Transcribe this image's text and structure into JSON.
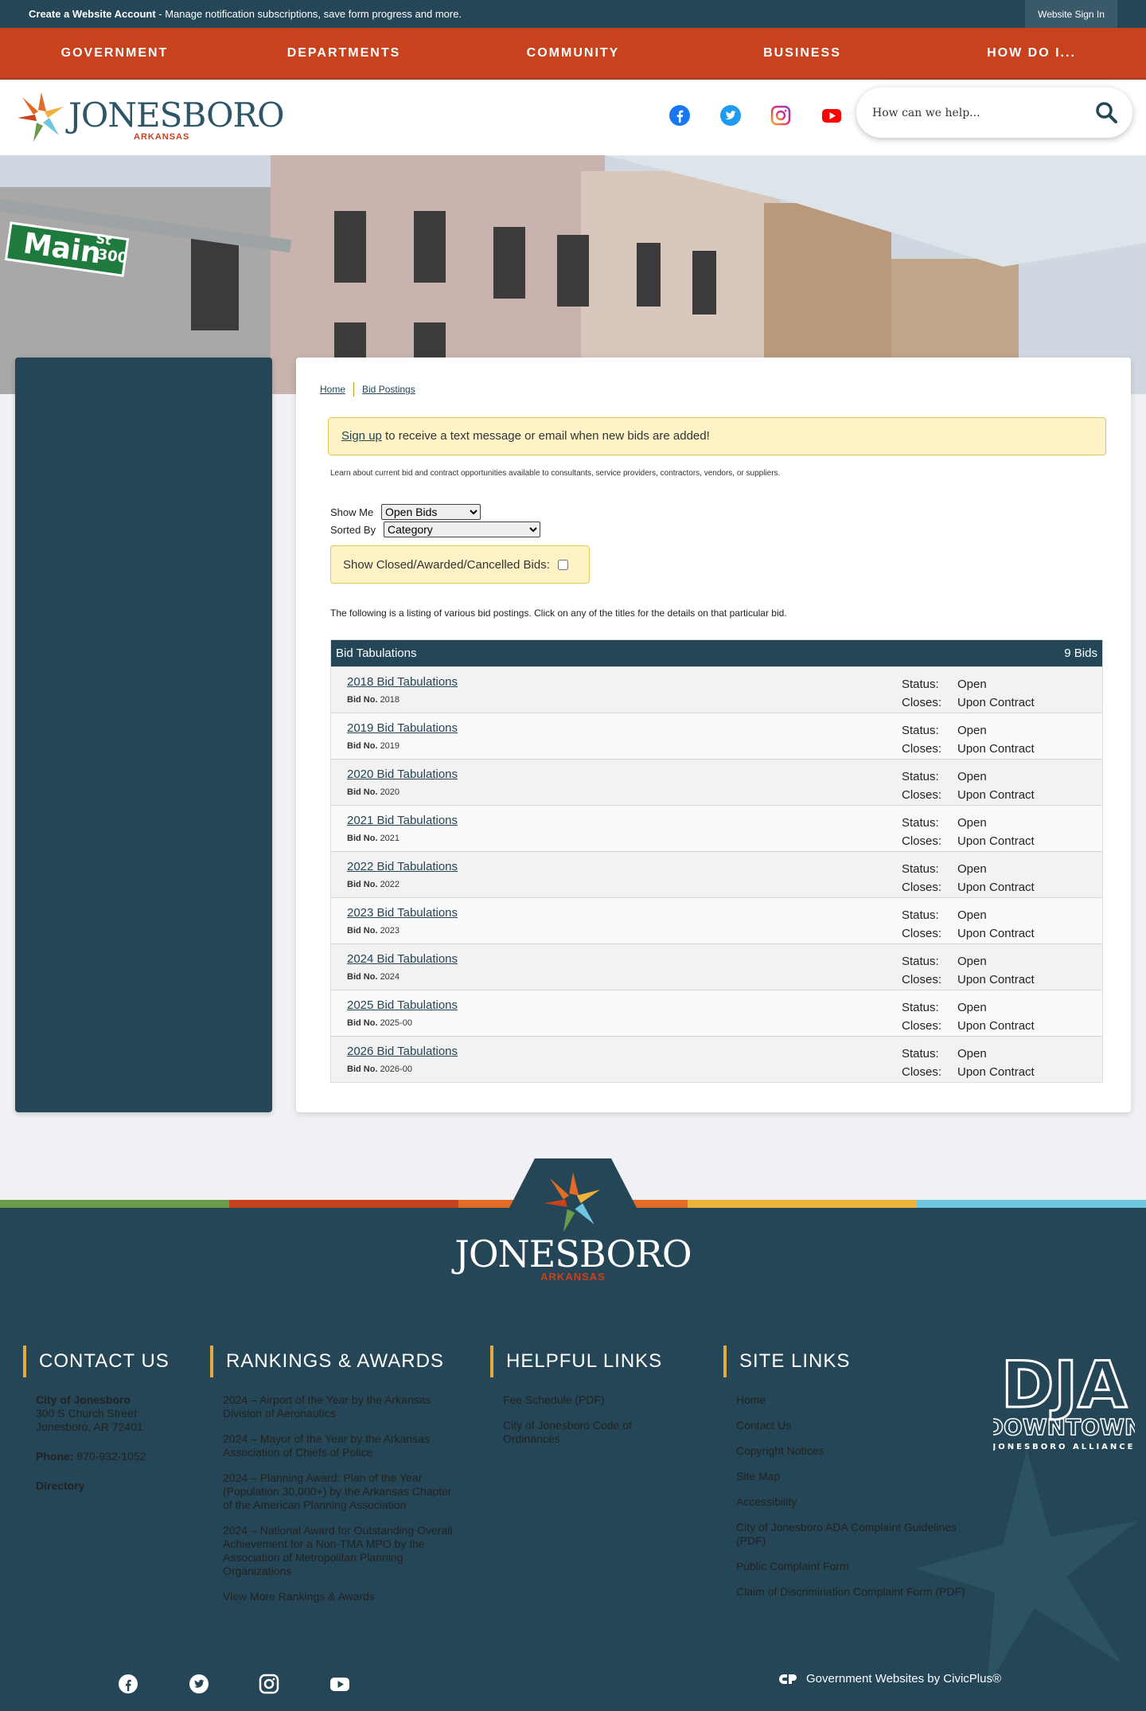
{
  "topbar": {
    "create_bold": "Create a Website Account",
    "create_rest": " - Manage notification subscriptions, save form progress and more.",
    "signin": "Website Sign In"
  },
  "nav": [
    "GOVERNMENT",
    "DEPARTMENTS",
    "COMMUNITY",
    "BUSINESS",
    "HOW DO I..."
  ],
  "header": {
    "logo_text": "JONESBORO",
    "logo_sub": "ARKANSAS",
    "search_placeholder": "How can we help...",
    "social": [
      "facebook-icon",
      "twitter-icon",
      "instagram-icon",
      "youtube-icon"
    ]
  },
  "breadcrumb": [
    "Home",
    "Bid Postings"
  ],
  "notice": {
    "link": "Sign up",
    "text": " to receive a text message or email when new bids are added!"
  },
  "intro": "Learn about current bid and contract opportunities available to consultants, service providers, contractors, vendors, or suppliers.",
  "filters": {
    "show_me_label": "Show Me",
    "show_me_value": "Open Bids",
    "sorted_by_label": "Sorted By",
    "sorted_by_value": "Category",
    "closed_label": "Show Closed/Awarded/Cancelled Bids:"
  },
  "listing_text": "The following is a listing of various bid postings. Click on any of the titles for the details on that particular bid.",
  "bid_table": {
    "title": "Bid Tabulations",
    "count": "9 Bids",
    "bid_no_label": "Bid No.",
    "status_label": "Status:",
    "closes_label": "Closes:",
    "rows": [
      {
        "title": "2018 Bid Tabulations",
        "bid_no": "2018",
        "status": "Open",
        "closes": "Upon Contract"
      },
      {
        "title": "2019 Bid Tabulations",
        "bid_no": "2019",
        "status": "Open",
        "closes": "Upon Contract"
      },
      {
        "title": "2020 Bid Tabulations",
        "bid_no": "2020",
        "status": "Open",
        "closes": "Upon Contract"
      },
      {
        "title": "2021 Bid Tabulations",
        "bid_no": "2021",
        "status": "Open",
        "closes": "Upon Contract"
      },
      {
        "title": "2022 Bid Tabulations",
        "bid_no": "2022",
        "status": "Open",
        "closes": "Upon Contract"
      },
      {
        "title": "2023 Bid Tabulations",
        "bid_no": "2023",
        "status": "Open",
        "closes": "Upon Contract"
      },
      {
        "title": "2024 Bid Tabulations",
        "bid_no": "2024",
        "status": "Open",
        "closes": "Upon Contract"
      },
      {
        "title": "2025 Bid Tabulations",
        "bid_no": "2025-00",
        "status": "Open",
        "closes": "Upon Contract"
      },
      {
        "title": "2026 Bid Tabulations",
        "bid_no": "2026-00",
        "status": "Open",
        "closes": "Upon Contract"
      }
    ]
  },
  "footer": {
    "logo_text": "JONESBORO",
    "logo_sub": "ARKANSAS",
    "contact": {
      "heading": "CONTACT US",
      "org": "City of Jonesboro",
      "street": "300 S Church Street",
      "city": "Jonesboro, AR 72401",
      "phone_label": "Phone:",
      "phone": " 870-932-1052",
      "directory": "Directory"
    },
    "rankings": {
      "heading": "RANKINGS & AWARDS",
      "items": [
        "2024 – Airport of the Year by the Arkansas Division of Aeronautics",
        "2024 – Mayor of the Year by the Arkansas Association of Chiefs of Police",
        "2024 – Planning Award: Plan of the Year (Population 30,000+) by the Arkansas Chapter of the American Planning Association",
        "2024 – National Award for Outstanding Overall Achievement for a Non-TMA MPO by the Association of Metropolitan Planning Organizations",
        "View More Rankings & Awards"
      ]
    },
    "helpful": {
      "heading": "HELPFUL LINKS",
      "items": [
        "Fee Schedule (PDF)",
        "City of Jonesboro Code of Ordinances"
      ]
    },
    "site": {
      "heading": "SITE LINKS",
      "items": [
        "Home",
        "Contact Us",
        "Copyright Notices",
        "Site Map",
        "Accessibility",
        "City of Jonesboro ADA Complaint Guidelines (PDF)",
        "Public Complaint Form",
        "Claim of Discrimination Complaint Form (PDF)"
      ]
    },
    "dja": {
      "big": "DJA",
      "mid": "DOWNTOWN",
      "small": "JONESBORO ALLIANCE"
    },
    "civic": "Government Websites by CivicPlus®"
  },
  "colors": {
    "primary": "#244656",
    "nav": "#c9421e",
    "accent_yellow": "#fdf3c7",
    "strip": [
      "#6a9a4a",
      "#c9421e",
      "#e36b25",
      "#f0b23a",
      "#6fc6e0"
    ]
  }
}
